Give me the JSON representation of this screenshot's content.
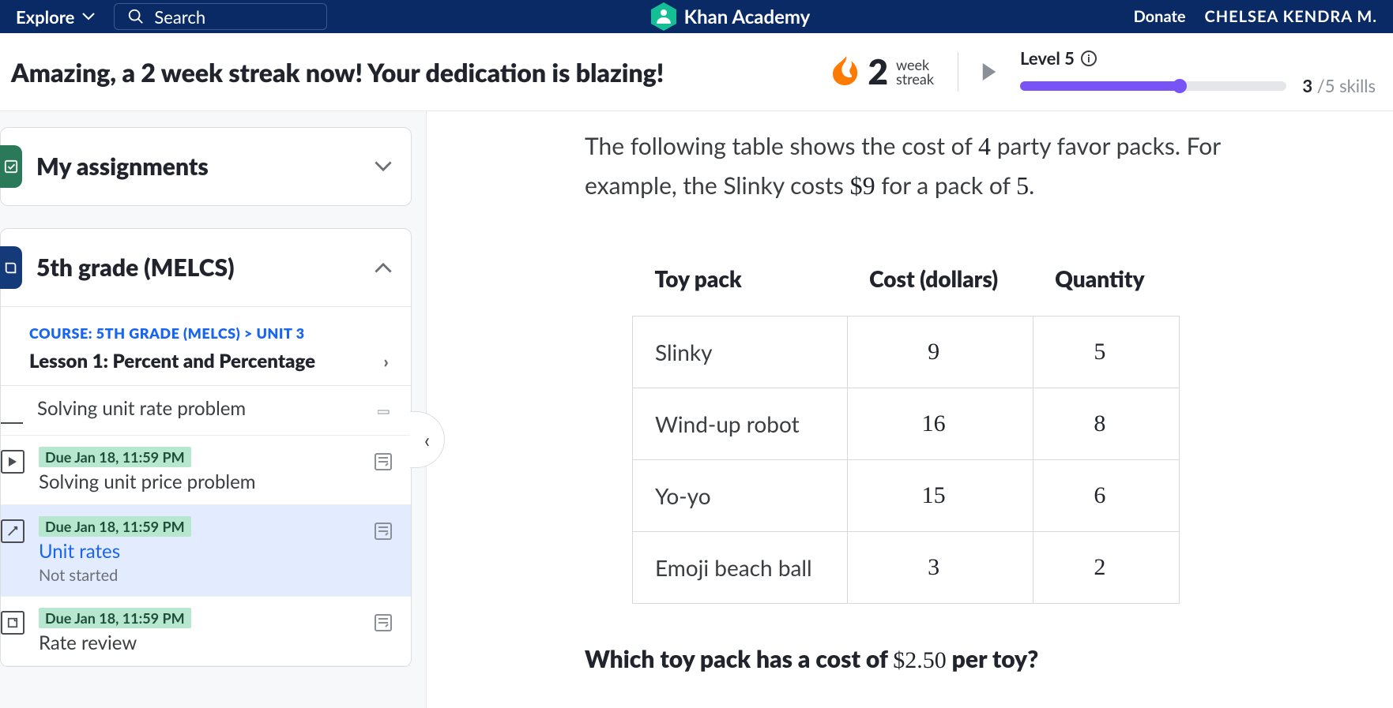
{
  "nav": {
    "explore": "Explore",
    "search_placeholder": "Search",
    "brand": "Khan Academy",
    "donate": "Donate",
    "user": "CHELSEA KENDRA M."
  },
  "banner": {
    "message": "Amazing, a 2 week streak now! Your dedication is blazing!",
    "streak_number": "2",
    "streak_unit_top": "week",
    "streak_unit_bottom": "streak",
    "level_label": "Level 5",
    "skills_done": "3",
    "skills_total": "/5 skills",
    "progress_pct": 60
  },
  "sidebar": {
    "assignments_title": "My assignments",
    "course_title": "5th grade (MELCS)",
    "crumb_course": "COURSE: 5TH GRADE (MELCS)",
    "crumb_sep": ">",
    "crumb_unit": "UNIT 3",
    "lesson_title": "Lesson 1: Percent and Percentage",
    "items": [
      {
        "name": "Solving unit rate problem",
        "due": "",
        "status": "",
        "link": false,
        "icon": "partial",
        "progress_icon": "square-small"
      },
      {
        "name": "Solving unit price problem",
        "due": "Due Jan 18, 11:59 PM",
        "status": "",
        "link": false,
        "icon": "video",
        "progress_icon": "exercise"
      },
      {
        "name": "Unit rates",
        "due": "Due Jan 18, 11:59 PM",
        "status": "Not started",
        "link": true,
        "icon": "exercise",
        "progress_icon": "exercise",
        "active": true
      },
      {
        "name": "Rate review",
        "due": "Due Jan 18, 11:59 PM",
        "status": "",
        "link": false,
        "icon": "article",
        "progress_icon": "exercise"
      }
    ]
  },
  "problem": {
    "prompt_a": "The following table shows the cost of ",
    "prompt_n1": "4",
    "prompt_b": " party favor packs. For example, the Slinky costs ",
    "prompt_n2": "$9",
    "prompt_c": " for a pack of ",
    "prompt_n3": "5",
    "prompt_d": ".",
    "headers": [
      "Toy pack",
      "Cost (dollars)",
      "Quantity"
    ],
    "rows": [
      {
        "toy": "Slinky",
        "cost": "9",
        "qty": "5"
      },
      {
        "toy": "Wind-up robot",
        "cost": "16",
        "qty": "8"
      },
      {
        "toy": "Yo-yo",
        "cost": "15",
        "qty": "6"
      },
      {
        "toy": "Emoji beach ball",
        "cost": "3",
        "qty": "2"
      }
    ],
    "question_a": "Which toy pack has a cost of ",
    "question_price": "$2.50",
    "question_b": " per toy?"
  }
}
